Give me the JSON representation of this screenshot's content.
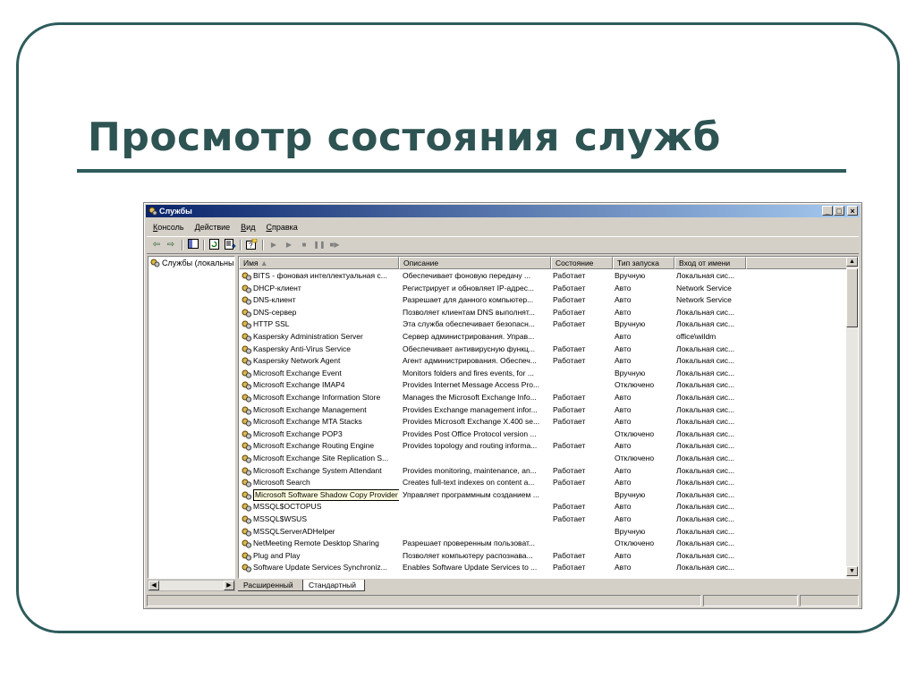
{
  "slide": {
    "title": "Просмотр состояния служб",
    "frame_color": "#2e5b5b",
    "title_color": "#2e5353"
  },
  "window": {
    "title": "Службы",
    "title_icon": "services-gear-icon",
    "controls": {
      "minimize": "_",
      "maximize": "□",
      "close": "×"
    },
    "menu": [
      "Консоль",
      "Действие",
      "Вид",
      "Справка"
    ],
    "toolbar_icons": [
      "back-arrow-icon",
      "forward-arrow-icon",
      "console-tree-icon",
      "refresh-icon",
      "export-list-icon",
      "help-icon",
      "play-icon",
      "play-alt-icon",
      "stop-icon",
      "pause-icon",
      "restart-icon"
    ],
    "tree": {
      "root_label": "Службы (локальны"
    },
    "columns": [
      "Имя",
      "Описание",
      "Состояние",
      "Тип запуска",
      "Вход от имени"
    ],
    "services": [
      {
        "name": "BITS - фоновая интеллектуальная с...",
        "description": "Обеспечивает фоновую передачу ...",
        "status": "Работает",
        "startup": "Вручную",
        "logon": "Локальная сис..."
      },
      {
        "name": "DHCP-клиент",
        "description": "Регистрирует и обновляет IP-адрес...",
        "status": "Работает",
        "startup": "Авто",
        "logon": "Network Service"
      },
      {
        "name": "DNS-клиент",
        "description": "Разрешает для данного компьютер...",
        "status": "Работает",
        "startup": "Авто",
        "logon": "Network Service"
      },
      {
        "name": "DNS-сервер",
        "description": "Позволяет клиентам DNS выполнят...",
        "status": "Работает",
        "startup": "Авто",
        "logon": "Локальная сис..."
      },
      {
        "name": "HTTP SSL",
        "description": "Эта служба обеспечивает безопасн...",
        "status": "Работает",
        "startup": "Вручную",
        "logon": "Локальная сис..."
      },
      {
        "name": "Kaspersky Administration Server",
        "description": "Сервер администрирования. Управ...",
        "status": "",
        "startup": "Авто",
        "logon": "office\\wildm"
      },
      {
        "name": "Kaspersky Anti-Virus Service",
        "description": "Обеспечивает антивирусную функц...",
        "status": "Работает",
        "startup": "Авто",
        "logon": "Локальная сис..."
      },
      {
        "name": "Kaspersky Network Agent",
        "description": "Агент администрирования. Обеспеч...",
        "status": "Работает",
        "startup": "Авто",
        "logon": "Локальная сис..."
      },
      {
        "name": "Microsoft Exchange Event",
        "description": "Monitors folders and fires events, for ...",
        "status": "",
        "startup": "Вручную",
        "logon": "Локальная сис..."
      },
      {
        "name": "Microsoft Exchange IMAP4",
        "description": "Provides Internet Message Access Pro...",
        "status": "",
        "startup": "Отключено",
        "logon": "Локальная сис..."
      },
      {
        "name": "Microsoft Exchange Information Store",
        "description": "Manages the Microsoft Exchange Info...",
        "status": "Работает",
        "startup": "Авто",
        "logon": "Локальная сис..."
      },
      {
        "name": "Microsoft Exchange Management",
        "description": "Provides Exchange management infor...",
        "status": "Работает",
        "startup": "Авто",
        "logon": "Локальная сис..."
      },
      {
        "name": "Microsoft Exchange MTA Stacks",
        "description": "Provides Microsoft Exchange X.400 se...",
        "status": "Работает",
        "startup": "Авто",
        "logon": "Локальная сис..."
      },
      {
        "name": "Microsoft Exchange POP3",
        "description": "Provides Post Office Protocol version ...",
        "status": "",
        "startup": "Отключено",
        "logon": "Локальная сис..."
      },
      {
        "name": "Microsoft Exchange Routing Engine",
        "description": "Provides topology and routing informa...",
        "status": "Работает",
        "startup": "Авто",
        "logon": "Локальная сис..."
      },
      {
        "name": "Microsoft Exchange Site Replication S...",
        "description": "",
        "status": "",
        "startup": "Отключено",
        "logon": "Локальная сис..."
      },
      {
        "name": "Microsoft Exchange System Attendant",
        "description": "Provides monitoring, maintenance, an...",
        "status": "Работает",
        "startup": "Авто",
        "logon": "Локальная сис..."
      },
      {
        "name": "Microsoft Search",
        "description": "Creates full-text indexes on content a...",
        "status": "Работает",
        "startup": "Авто",
        "logon": "Локальная сис..."
      },
      {
        "name": "Microsoft Software Shadow Copy Provider",
        "description": "Управляет программным созданием ...",
        "status": "",
        "startup": "Вручную",
        "logon": "Локальная сис...",
        "tooltip": true
      },
      {
        "name": "MSSQL$OCTOPUS",
        "description": "",
        "status": "Работает",
        "startup": "Авто",
        "logon": "Локальная сис..."
      },
      {
        "name": "MSSQL$WSUS",
        "description": "",
        "status": "Работает",
        "startup": "Авто",
        "logon": "Локальная сис..."
      },
      {
        "name": "MSSQLServerADHelper",
        "description": "",
        "status": "",
        "startup": "Вручную",
        "logon": "Локальная сис..."
      },
      {
        "name": "NetMeeting Remote Desktop Sharing",
        "description": "Разрешает проверенным пользоват...",
        "status": "",
        "startup": "Отключено",
        "logon": "Локальная сис..."
      },
      {
        "name": "Plug and Play",
        "description": "Позволяет компьютеру распознава...",
        "status": "Работает",
        "startup": "Авто",
        "logon": "Локальная сис..."
      },
      {
        "name": "Software Update Services Synchroniz...",
        "description": "Enables Software Update Services to ...",
        "status": "Работает",
        "startup": "Авто",
        "logon": "Локальная сис..."
      }
    ],
    "tabs": [
      {
        "label": "Расширенный",
        "active": false
      },
      {
        "label": "Стандартный",
        "active": true
      }
    ]
  }
}
